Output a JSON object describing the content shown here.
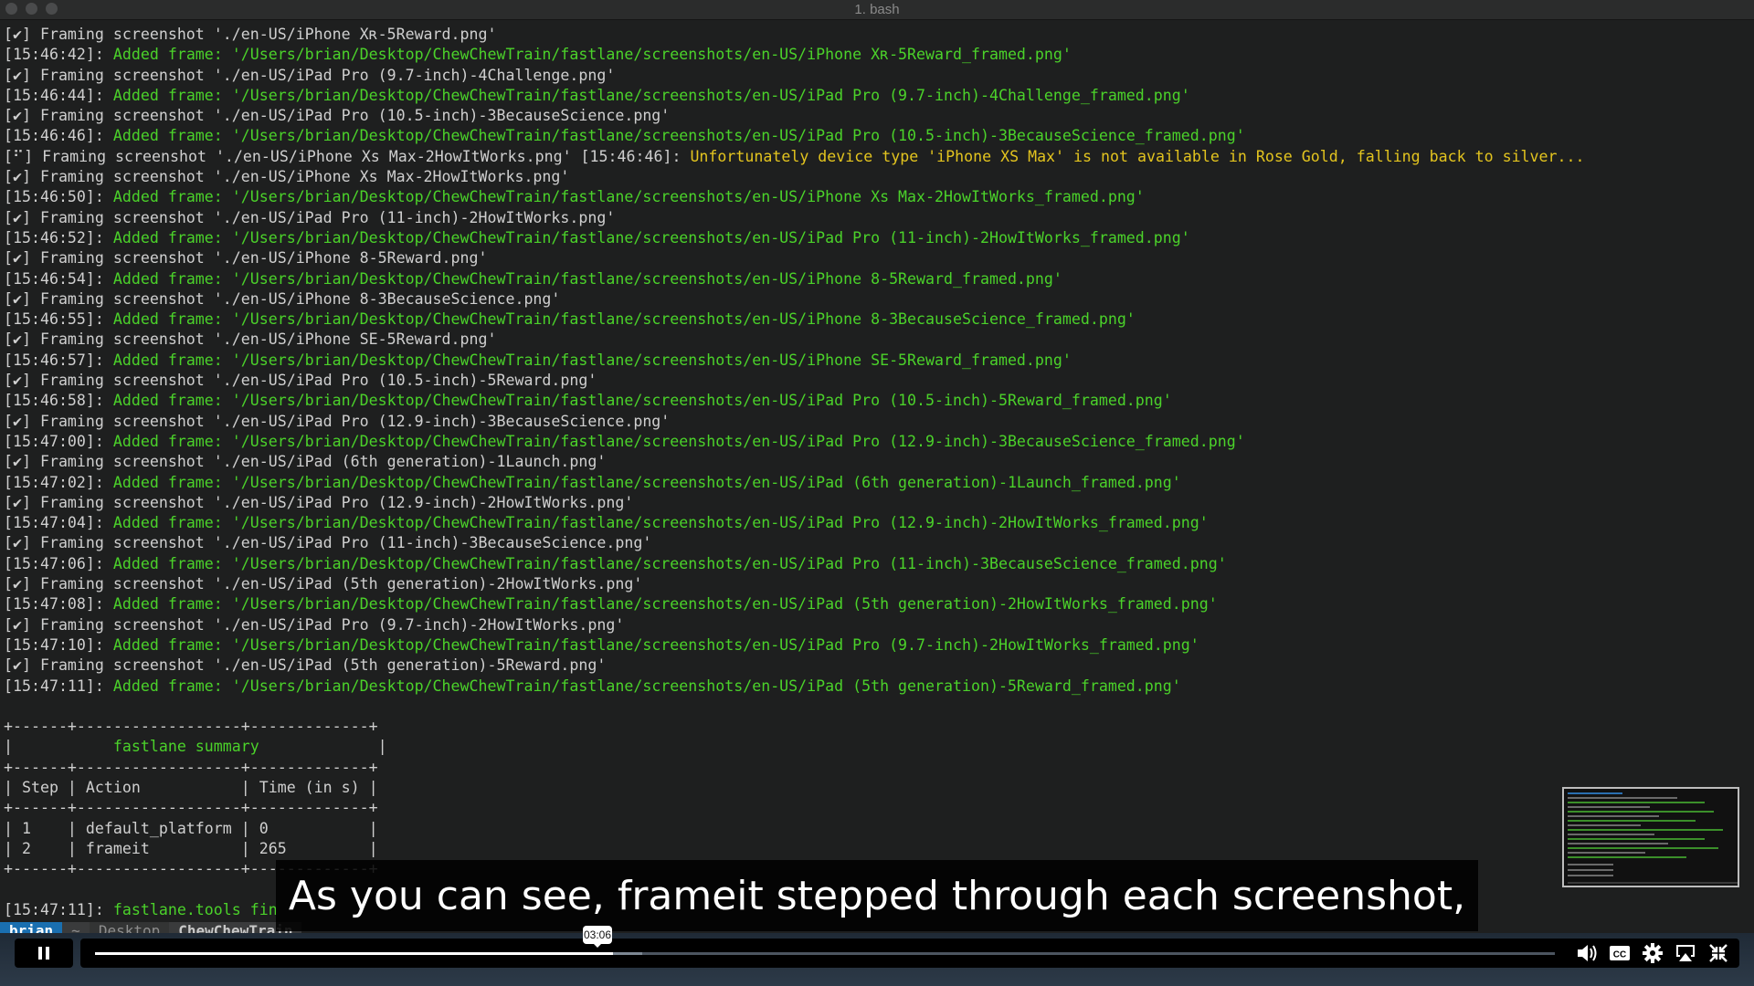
{
  "window": {
    "title": "1. bash"
  },
  "terminal_lines": [
    [
      {
        "t": "[✔] Framing screenshot './en-US/iPhone Xʀ-5Reward.png'",
        "c": ""
      }
    ],
    [
      {
        "t": "[15:46:42]: ",
        "c": ""
      },
      {
        "t": "Added frame: '/Users/brian/Desktop/ChewChewTrain/fastlane/screenshots/en-US/iPhone Xʀ-5Reward_framed.png'",
        "c": "g"
      }
    ],
    [
      {
        "t": "[✔] Framing screenshot './en-US/iPad Pro (9.7-inch)-4Challenge.png'",
        "c": ""
      }
    ],
    [
      {
        "t": "[15:46:44]: ",
        "c": ""
      },
      {
        "t": "Added frame: '/Users/brian/Desktop/ChewChewTrain/fastlane/screenshots/en-US/iPad Pro (9.7-inch)-4Challenge_framed.png'",
        "c": "g"
      }
    ],
    [
      {
        "t": "[✔] Framing screenshot './en-US/iPad Pro (10.5-inch)-3BecauseScience.png'",
        "c": ""
      }
    ],
    [
      {
        "t": "[15:46:46]: ",
        "c": ""
      },
      {
        "t": "Added frame: '/Users/brian/Desktop/ChewChewTrain/fastlane/screenshots/en-US/iPad Pro (10.5-inch)-3BecauseScience_framed.png'",
        "c": "g"
      }
    ],
    [
      {
        "t": "[⠋] Framing screenshot './en-US/iPhone Xs Max-2HowItWorks.png' [15:46:46]: ",
        "c": ""
      },
      {
        "t": "Unfortunately device type 'iPhone XS Max' is not available in Rose Gold, falling back to silver...",
        "c": "y"
      }
    ],
    [
      {
        "t": "[✔] Framing screenshot './en-US/iPhone Xs Max-2HowItWorks.png'",
        "c": ""
      }
    ],
    [
      {
        "t": "[15:46:50]: ",
        "c": ""
      },
      {
        "t": "Added frame: '/Users/brian/Desktop/ChewChewTrain/fastlane/screenshots/en-US/iPhone Xs Max-2HowItWorks_framed.png'",
        "c": "g"
      }
    ],
    [
      {
        "t": "[✔] Framing screenshot './en-US/iPad Pro (11-inch)-2HowItWorks.png'",
        "c": ""
      }
    ],
    [
      {
        "t": "[15:46:52]: ",
        "c": ""
      },
      {
        "t": "Added frame: '/Users/brian/Desktop/ChewChewTrain/fastlane/screenshots/en-US/iPad Pro (11-inch)-2HowItWorks_framed.png'",
        "c": "g"
      }
    ],
    [
      {
        "t": "[✔] Framing screenshot './en-US/iPhone 8-5Reward.png'",
        "c": ""
      }
    ],
    [
      {
        "t": "[15:46:54]: ",
        "c": ""
      },
      {
        "t": "Added frame: '/Users/brian/Desktop/ChewChewTrain/fastlane/screenshots/en-US/iPhone 8-5Reward_framed.png'",
        "c": "g"
      }
    ],
    [
      {
        "t": "[✔] Framing screenshot './en-US/iPhone 8-3BecauseScience.png'",
        "c": ""
      }
    ],
    [
      {
        "t": "[15:46:55]: ",
        "c": ""
      },
      {
        "t": "Added frame: '/Users/brian/Desktop/ChewChewTrain/fastlane/screenshots/en-US/iPhone 8-3BecauseScience_framed.png'",
        "c": "g"
      }
    ],
    [
      {
        "t": "[✔] Framing screenshot './en-US/iPhone SE-5Reward.png'",
        "c": ""
      }
    ],
    [
      {
        "t": "[15:46:57]: ",
        "c": ""
      },
      {
        "t": "Added frame: '/Users/brian/Desktop/ChewChewTrain/fastlane/screenshots/en-US/iPhone SE-5Reward_framed.png'",
        "c": "g"
      }
    ],
    [
      {
        "t": "[✔] Framing screenshot './en-US/iPad Pro (10.5-inch)-5Reward.png'",
        "c": ""
      }
    ],
    [
      {
        "t": "[15:46:58]: ",
        "c": ""
      },
      {
        "t": "Added frame: '/Users/brian/Desktop/ChewChewTrain/fastlane/screenshots/en-US/iPad Pro (10.5-inch)-5Reward_framed.png'",
        "c": "g"
      }
    ],
    [
      {
        "t": "[✔] Framing screenshot './en-US/iPad Pro (12.9-inch)-3BecauseScience.png'",
        "c": ""
      }
    ],
    [
      {
        "t": "[15:47:00]: ",
        "c": ""
      },
      {
        "t": "Added frame: '/Users/brian/Desktop/ChewChewTrain/fastlane/screenshots/en-US/iPad Pro (12.9-inch)-3BecauseScience_framed.png'",
        "c": "g"
      }
    ],
    [
      {
        "t": "[✔] Framing screenshot './en-US/iPad (6th generation)-1Launch.png'",
        "c": ""
      }
    ],
    [
      {
        "t": "[15:47:02]: ",
        "c": ""
      },
      {
        "t": "Added frame: '/Users/brian/Desktop/ChewChewTrain/fastlane/screenshots/en-US/iPad (6th generation)-1Launch_framed.png'",
        "c": "g"
      }
    ],
    [
      {
        "t": "[✔] Framing screenshot './en-US/iPad Pro (12.9-inch)-2HowItWorks.png'",
        "c": ""
      }
    ],
    [
      {
        "t": "[15:47:04]: ",
        "c": ""
      },
      {
        "t": "Added frame: '/Users/brian/Desktop/ChewChewTrain/fastlane/screenshots/en-US/iPad Pro (12.9-inch)-2HowItWorks_framed.png'",
        "c": "g"
      }
    ],
    [
      {
        "t": "[✔] Framing screenshot './en-US/iPad Pro (11-inch)-3BecauseScience.png'",
        "c": ""
      }
    ],
    [
      {
        "t": "[15:47:06]: ",
        "c": ""
      },
      {
        "t": "Added frame: '/Users/brian/Desktop/ChewChewTrain/fastlane/screenshots/en-US/iPad Pro (11-inch)-3BecauseScience_framed.png'",
        "c": "g"
      }
    ],
    [
      {
        "t": "[✔] Framing screenshot './en-US/iPad (5th generation)-2HowItWorks.png'",
        "c": ""
      }
    ],
    [
      {
        "t": "[15:47:08]: ",
        "c": ""
      },
      {
        "t": "Added frame: '/Users/brian/Desktop/ChewChewTrain/fastlane/screenshots/en-US/iPad (5th generation)-2HowItWorks_framed.png'",
        "c": "g"
      }
    ],
    [
      {
        "t": "[✔] Framing screenshot './en-US/iPad Pro (9.7-inch)-2HowItWorks.png'",
        "c": ""
      }
    ],
    [
      {
        "t": "[15:47:10]: ",
        "c": ""
      },
      {
        "t": "Added frame: '/Users/brian/Desktop/ChewChewTrain/fastlane/screenshots/en-US/iPad Pro (9.7-inch)-2HowItWorks_framed.png'",
        "c": "g"
      }
    ],
    [
      {
        "t": "[✔] Framing screenshot './en-US/iPad (5th generation)-5Reward.png'",
        "c": ""
      }
    ],
    [
      {
        "t": "[15:47:11]: ",
        "c": ""
      },
      {
        "t": "Added frame: '/Users/brian/Desktop/ChewChewTrain/fastlane/screenshots/en-US/iPad (5th generation)-5Reward_framed.png'",
        "c": "g"
      }
    ]
  ],
  "summary_lines": [
    [
      {
        "t": "+------+------------------+-------------+",
        "c": ""
      }
    ],
    [
      {
        "t": "|           ",
        "c": ""
      },
      {
        "t": "fastlane summary",
        "c": "g"
      },
      {
        "t": "             |",
        "c": ""
      }
    ],
    [
      {
        "t": "+------+------------------+-------------+",
        "c": ""
      }
    ],
    [
      {
        "t": "| Step | Action           | Time (in s) |",
        "c": ""
      }
    ],
    [
      {
        "t": "+------+------------------+-------------+",
        "c": ""
      }
    ],
    [
      {
        "t": "| 1    | default_platform | 0           |",
        "c": ""
      }
    ],
    [
      {
        "t": "| 2    | frameit          | 265         |",
        "c": ""
      }
    ],
    [
      {
        "t": "+------+------------------+-------------+",
        "c": ""
      }
    ]
  ],
  "final_line": [
    {
      "t": "[15:47:11]: ",
      "c": ""
    },
    {
      "t": "fastlane.tools fin",
      "c": "g"
    }
  ],
  "statusbar": {
    "user": "brian",
    "tilde": "~",
    "dir1": "Desktop",
    "dir2": "ChewChewTrain"
  },
  "subtitle": "As you can see, frameit stepped through each screenshot,",
  "player": {
    "time_tooltip": "03:06",
    "progress_fraction": 0.355,
    "buffered_fraction": 0.375
  },
  "icons": {
    "pause": "pause-icon",
    "volume": "volume-icon",
    "cc": "captions-icon",
    "settings": "gear-icon",
    "airplay": "airplay-icon",
    "fullscreen": "exit-fullscreen-icon"
  },
  "colors": {
    "green": "#4bd22a",
    "yellow": "#e3c41f",
    "text": "#cfcfcf",
    "background": "#1e1f1f"
  }
}
